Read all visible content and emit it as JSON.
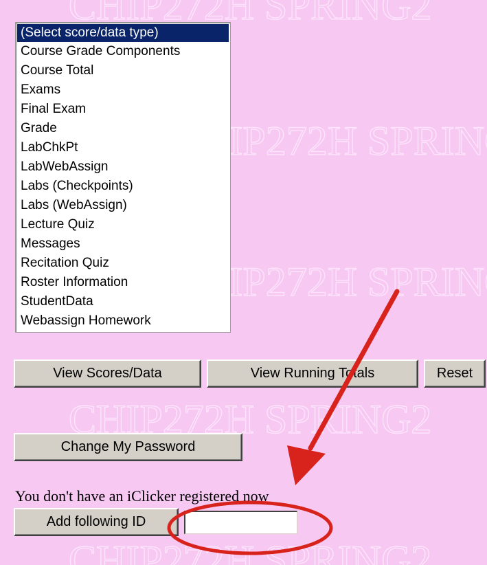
{
  "watermark": {
    "text": "CHIP272H SPRING2",
    "color": "#fde3fb"
  },
  "score_select": {
    "options": [
      "(Select score/data type)",
      "Course Grade Components",
      "Course Total",
      "Exams",
      "Final Exam",
      "Grade",
      "LabChkPt",
      "LabWebAssign",
      "Labs (Checkpoints)",
      "Labs (WebAssign)",
      "Lecture Quiz",
      "Messages",
      "Recitation Quiz",
      "Roster Information",
      "StudentData",
      "Webassign Homework"
    ],
    "selected_index": 0,
    "selection_color": "#0a246a"
  },
  "buttons": {
    "view_scores": "View Scores/Data",
    "view_running_totals": "View Running Totals",
    "reset": "Reset",
    "change_password": "Change My Password",
    "add_id": "Add following ID"
  },
  "iclicker": {
    "message": "You don't have an iClicker registered now",
    "id_value": ""
  },
  "annotation": {
    "arrow_icon": "arrow-icon",
    "circle_icon": "ellipse-highlight-icon",
    "color": "#d8231c"
  },
  "colors": {
    "background": "#f6c8f2",
    "button_face": "#d4d0c8"
  }
}
